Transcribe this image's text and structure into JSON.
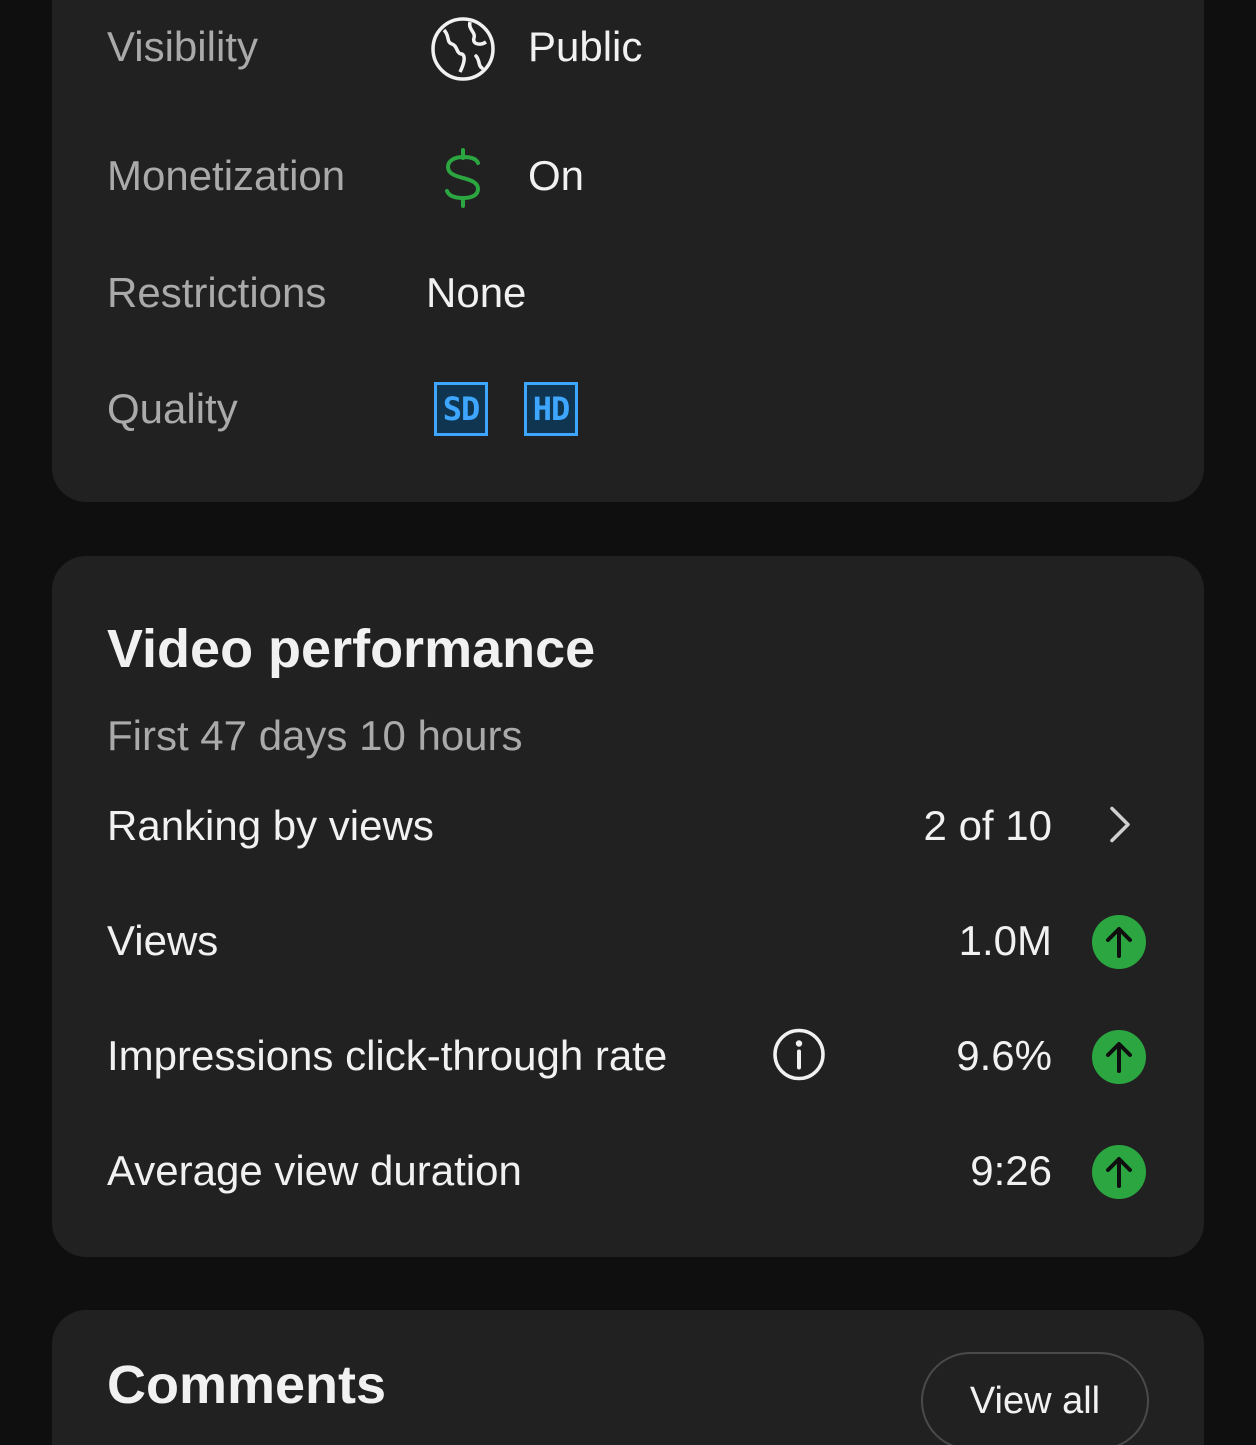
{
  "details": {
    "visibility": {
      "label": "Visibility",
      "value": "Public",
      "icon": "globe-icon"
    },
    "monetization": {
      "label": "Monetization",
      "value": "On",
      "icon": "dollar-icon",
      "icon_color": "#2ba640"
    },
    "restrictions": {
      "label": "Restrictions",
      "value": "None"
    },
    "quality": {
      "label": "Quality",
      "badges": [
        "SD",
        "HD"
      ],
      "badge_color": "#3ea6ff"
    }
  },
  "performance": {
    "title": "Video performance",
    "subtitle": "First 47 days 10 hours",
    "ranking": {
      "label": "Ranking by views",
      "value": "2 of 10",
      "icon": "chevron-right-icon"
    },
    "views": {
      "label": "Views",
      "value": "1.0M",
      "trend_icon": "arrow-up-icon"
    },
    "ctr": {
      "label": "Impressions click-through rate",
      "value": "9.6%",
      "info_icon": "info-icon",
      "trend_icon": "arrow-up-icon"
    },
    "avg_duration": {
      "label": "Average view duration",
      "value": "9:26",
      "trend_icon": "arrow-up-icon"
    },
    "trend_color": "#2ba640"
  },
  "comments": {
    "title": "Comments",
    "view_all_label": "View all"
  }
}
